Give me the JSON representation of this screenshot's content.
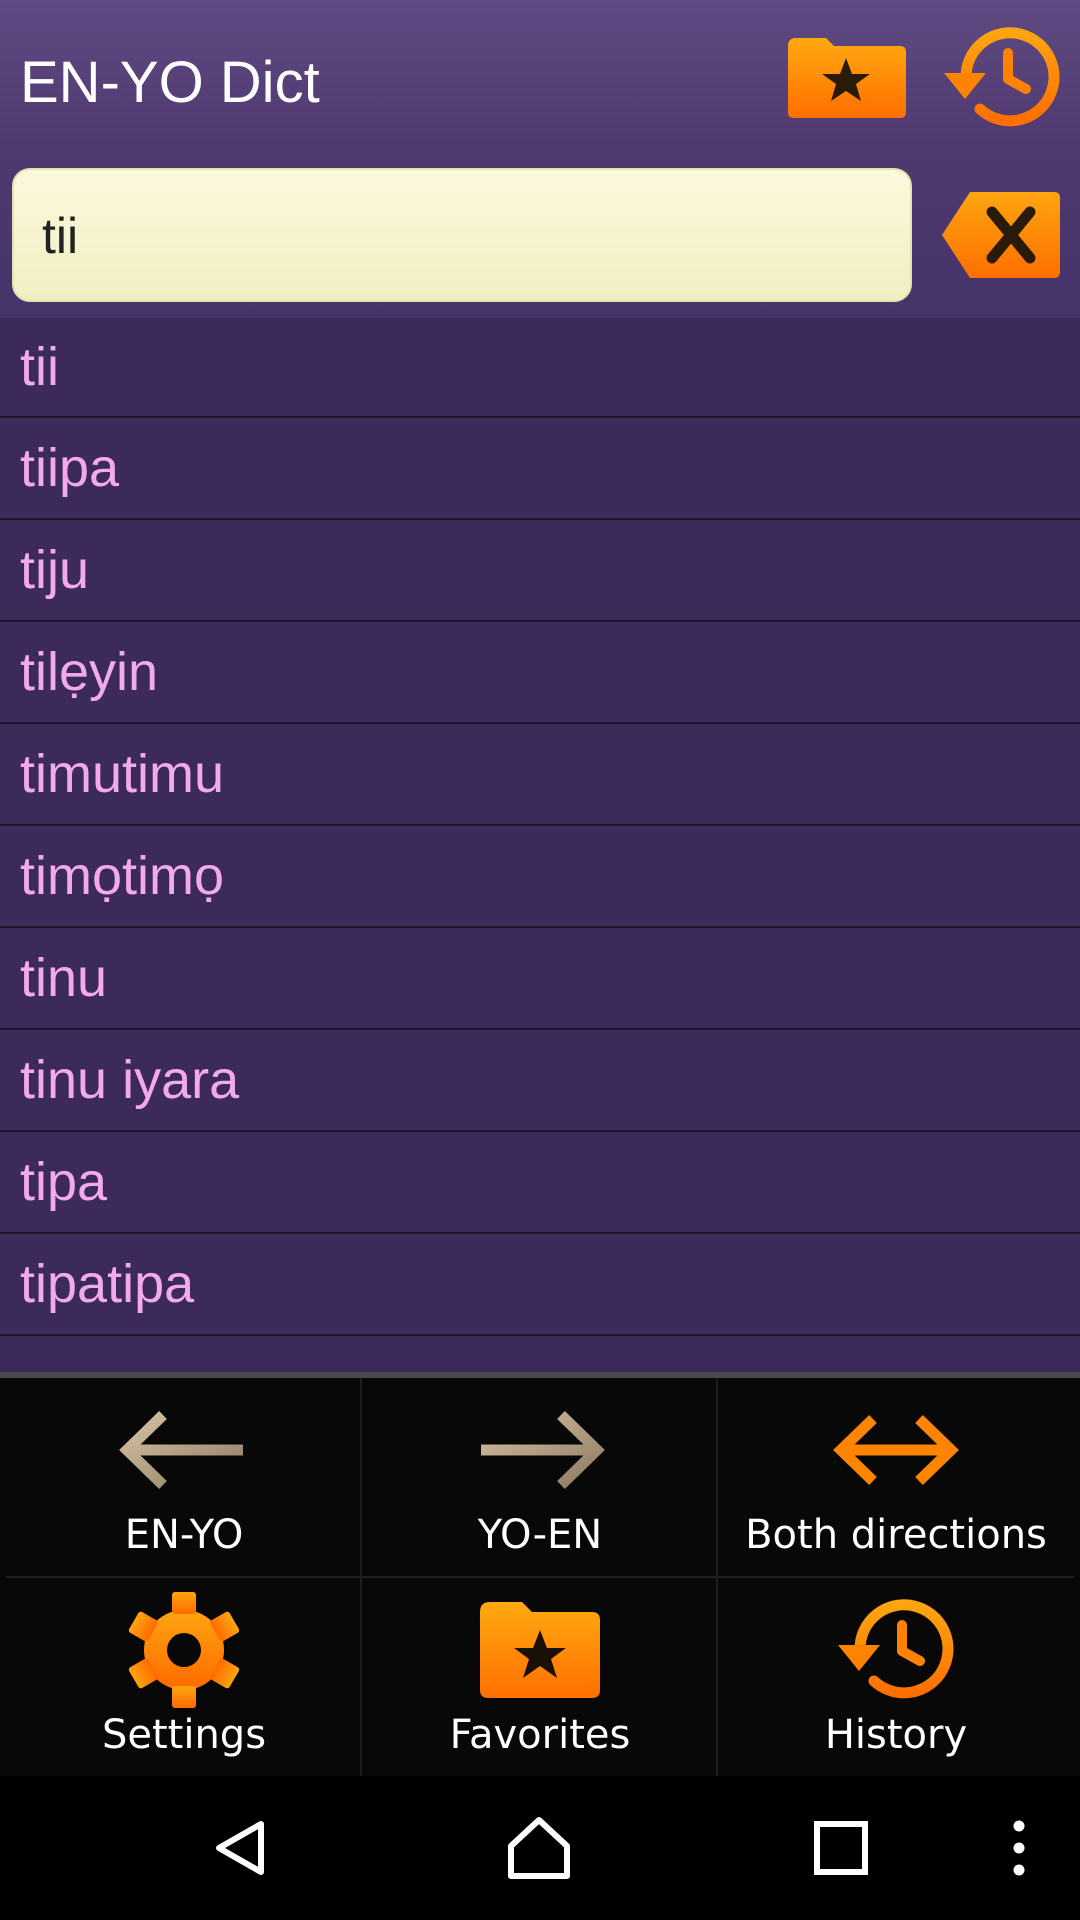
{
  "header": {
    "title": "EN-YO Dict",
    "favorites_icon": "star-folder-icon",
    "history_icon": "history-clock-icon"
  },
  "search": {
    "value": "tii",
    "clear_icon": "backspace-clear-icon"
  },
  "results": [
    "tii",
    "tiipa",
    "tiju",
    "tilẹyin",
    "timutimu",
    "timọtimọ",
    "tinu",
    "tinu iyara",
    "tipa",
    "tipatipa"
  ],
  "panel": {
    "en_yo": "EN-YO",
    "yo_en": "YO-EN",
    "both": "Both directions",
    "settings": "Settings",
    "favorites": "Favorites",
    "history": "History"
  },
  "colors": {
    "accent_orange": "#ff8a00",
    "list_bg": "#3c2a5a",
    "list_text": "#f2a9ee",
    "header_bg": "#5a4580",
    "search_bg": "#f8f6d2"
  }
}
